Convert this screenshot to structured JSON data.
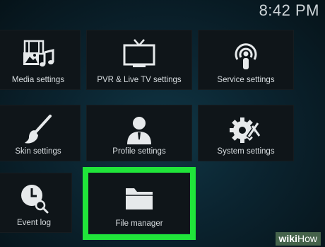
{
  "status_bar": {
    "time": "8:42 PM"
  },
  "tiles": {
    "media": {
      "label": "Media settings",
      "icon": "media-icon"
    },
    "pvr": {
      "label": "PVR & Live TV settings",
      "icon": "tv-icon"
    },
    "service": {
      "label": "Service settings",
      "icon": "broadcast-icon"
    },
    "skin": {
      "label": "Skin settings",
      "icon": "paintbrush-icon"
    },
    "profile": {
      "label": "Profile settings",
      "icon": "person-icon"
    },
    "system": {
      "label": "System settings",
      "icon": "gears-icon"
    },
    "event_log": {
      "label": "Event log",
      "icon": "clock-search-icon"
    },
    "file_manager": {
      "label": "File manager",
      "icon": "folder-icon"
    }
  },
  "highlight": {
    "target": "File manager",
    "color": "#20e53a"
  },
  "watermark": {
    "part1": "wiki",
    "part2": "How"
  }
}
